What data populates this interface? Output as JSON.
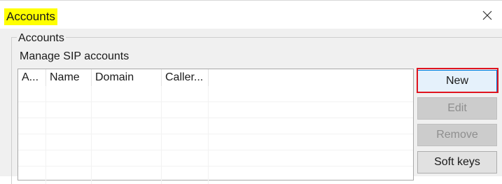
{
  "window": {
    "title": "Accounts",
    "close_icon": "close-icon",
    "title_highlight_color": "#ffff00"
  },
  "group": {
    "legend": "Accounts",
    "subtitle": "Manage SIP accounts"
  },
  "accounts_table": {
    "columns": [
      "A...",
      "Name",
      "Domain",
      "Caller..."
    ],
    "rows": []
  },
  "buttons": {
    "new": "New",
    "edit": "Edit",
    "remove": "Remove",
    "soft_keys": "Soft keys"
  },
  "annotations": {
    "new_button_highlight_color": "#e0141e"
  }
}
